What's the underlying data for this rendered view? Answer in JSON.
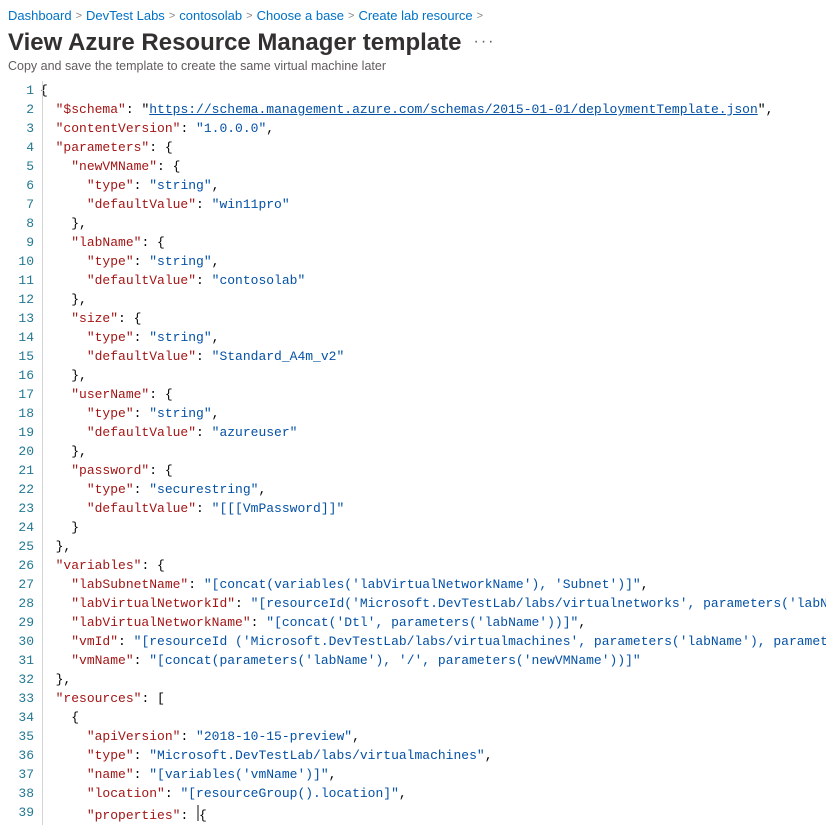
{
  "breadcrumb": [
    "Dashboard",
    "DevTest Labs",
    "contosolab",
    "Choose a base",
    "Create lab resource"
  ],
  "title": "View Azure Resource Manager template",
  "subtitle": "Copy and save the template to create the same virtual machine later",
  "code_lines": [
    {
      "n": 1,
      "t": "plain",
      "text": "{"
    },
    {
      "n": 2,
      "t": "kv",
      "indent": 2,
      "key": "$schema",
      "vtype": "url",
      "value": "https://schema.management.azure.com/schemas/2015-01-01/deploymentTemplate.json",
      "comma": true
    },
    {
      "n": 3,
      "t": "kv",
      "indent": 2,
      "key": "contentVersion",
      "vtype": "str",
      "value": "1.0.0.0",
      "comma": true
    },
    {
      "n": 4,
      "t": "kobj",
      "indent": 2,
      "key": "parameters"
    },
    {
      "n": 5,
      "t": "kobj",
      "indent": 4,
      "key": "newVMName"
    },
    {
      "n": 6,
      "t": "kv",
      "indent": 6,
      "key": "type",
      "vtype": "str",
      "value": "string",
      "comma": true
    },
    {
      "n": 7,
      "t": "kv",
      "indent": 6,
      "key": "defaultValue",
      "vtype": "str",
      "value": "win11pro",
      "comma": false
    },
    {
      "n": 8,
      "t": "close",
      "indent": 4,
      "comma": true
    },
    {
      "n": 9,
      "t": "kobj",
      "indent": 4,
      "key": "labName"
    },
    {
      "n": 10,
      "t": "kv",
      "indent": 6,
      "key": "type",
      "vtype": "str",
      "value": "string",
      "comma": true
    },
    {
      "n": 11,
      "t": "kv",
      "indent": 6,
      "key": "defaultValue",
      "vtype": "str",
      "value": "contosolab",
      "comma": false
    },
    {
      "n": 12,
      "t": "close",
      "indent": 4,
      "comma": true
    },
    {
      "n": 13,
      "t": "kobj",
      "indent": 4,
      "key": "size"
    },
    {
      "n": 14,
      "t": "kv",
      "indent": 6,
      "key": "type",
      "vtype": "str",
      "value": "string",
      "comma": true
    },
    {
      "n": 15,
      "t": "kv",
      "indent": 6,
      "key": "defaultValue",
      "vtype": "str",
      "value": "Standard_A4m_v2",
      "comma": false
    },
    {
      "n": 16,
      "t": "close",
      "indent": 4,
      "comma": true
    },
    {
      "n": 17,
      "t": "kobj",
      "indent": 4,
      "key": "userName"
    },
    {
      "n": 18,
      "t": "kv",
      "indent": 6,
      "key": "type",
      "vtype": "str",
      "value": "string",
      "comma": true
    },
    {
      "n": 19,
      "t": "kv",
      "indent": 6,
      "key": "defaultValue",
      "vtype": "str",
      "value": "azureuser",
      "comma": false
    },
    {
      "n": 20,
      "t": "close",
      "indent": 4,
      "comma": true
    },
    {
      "n": 21,
      "t": "kobj",
      "indent": 4,
      "key": "password"
    },
    {
      "n": 22,
      "t": "kv",
      "indent": 6,
      "key": "type",
      "vtype": "str",
      "value": "securestring",
      "comma": true
    },
    {
      "n": 23,
      "t": "kv",
      "indent": 6,
      "key": "defaultValue",
      "vtype": "str",
      "value": "[[[VmPassword]]",
      "comma": false
    },
    {
      "n": 24,
      "t": "close",
      "indent": 4,
      "comma": false
    },
    {
      "n": 25,
      "t": "close",
      "indent": 2,
      "comma": true
    },
    {
      "n": 26,
      "t": "kobj",
      "indent": 2,
      "key": "variables"
    },
    {
      "n": 27,
      "t": "kv",
      "indent": 4,
      "key": "labSubnetName",
      "vtype": "str",
      "value": "[concat(variables('labVirtualNetworkName'), 'Subnet')]",
      "comma": true
    },
    {
      "n": 28,
      "t": "kv",
      "indent": 4,
      "key": "labVirtualNetworkId",
      "vtype": "str",
      "value": "[resourceId('Microsoft.DevTestLab/labs/virtualnetworks', parameters('labName'), variables('labVirtualNetworkName'))]",
      "comma": true,
      "truncate": true
    },
    {
      "n": 29,
      "t": "kv",
      "indent": 4,
      "key": "labVirtualNetworkName",
      "vtype": "str",
      "value": "[concat('Dtl', parameters('labName'))]",
      "comma": true
    },
    {
      "n": 30,
      "t": "kv",
      "indent": 4,
      "key": "vmId",
      "vtype": "str",
      "value": "[resourceId ('Microsoft.DevTestLab/labs/virtualmachines', parameters('labName'), parameters('newVMName'))]",
      "comma": true,
      "truncate": true
    },
    {
      "n": 31,
      "t": "kv",
      "indent": 4,
      "key": "vmName",
      "vtype": "str",
      "value": "[concat(parameters('labName'), '/', parameters('newVMName'))]",
      "comma": false
    },
    {
      "n": 32,
      "t": "close",
      "indent": 2,
      "comma": true
    },
    {
      "n": 33,
      "t": "karr",
      "indent": 2,
      "key": "resources"
    },
    {
      "n": 34,
      "t": "plain",
      "indent": 4,
      "text": "{"
    },
    {
      "n": 35,
      "t": "kv",
      "indent": 6,
      "key": "apiVersion",
      "vtype": "str",
      "value": "2018-10-15-preview",
      "comma": true
    },
    {
      "n": 36,
      "t": "kv",
      "indent": 6,
      "key": "type",
      "vtype": "str",
      "value": "Microsoft.DevTestLab/labs/virtualmachines",
      "comma": true
    },
    {
      "n": 37,
      "t": "kv",
      "indent": 6,
      "key": "name",
      "vtype": "str",
      "value": "[variables('vmName')]",
      "comma": true
    },
    {
      "n": 38,
      "t": "kv",
      "indent": 6,
      "key": "location",
      "vtype": "str",
      "value": "[resourceGroup().location]",
      "comma": true
    },
    {
      "n": 39,
      "t": "kobj_cursor",
      "indent": 6,
      "key": "properties"
    }
  ]
}
